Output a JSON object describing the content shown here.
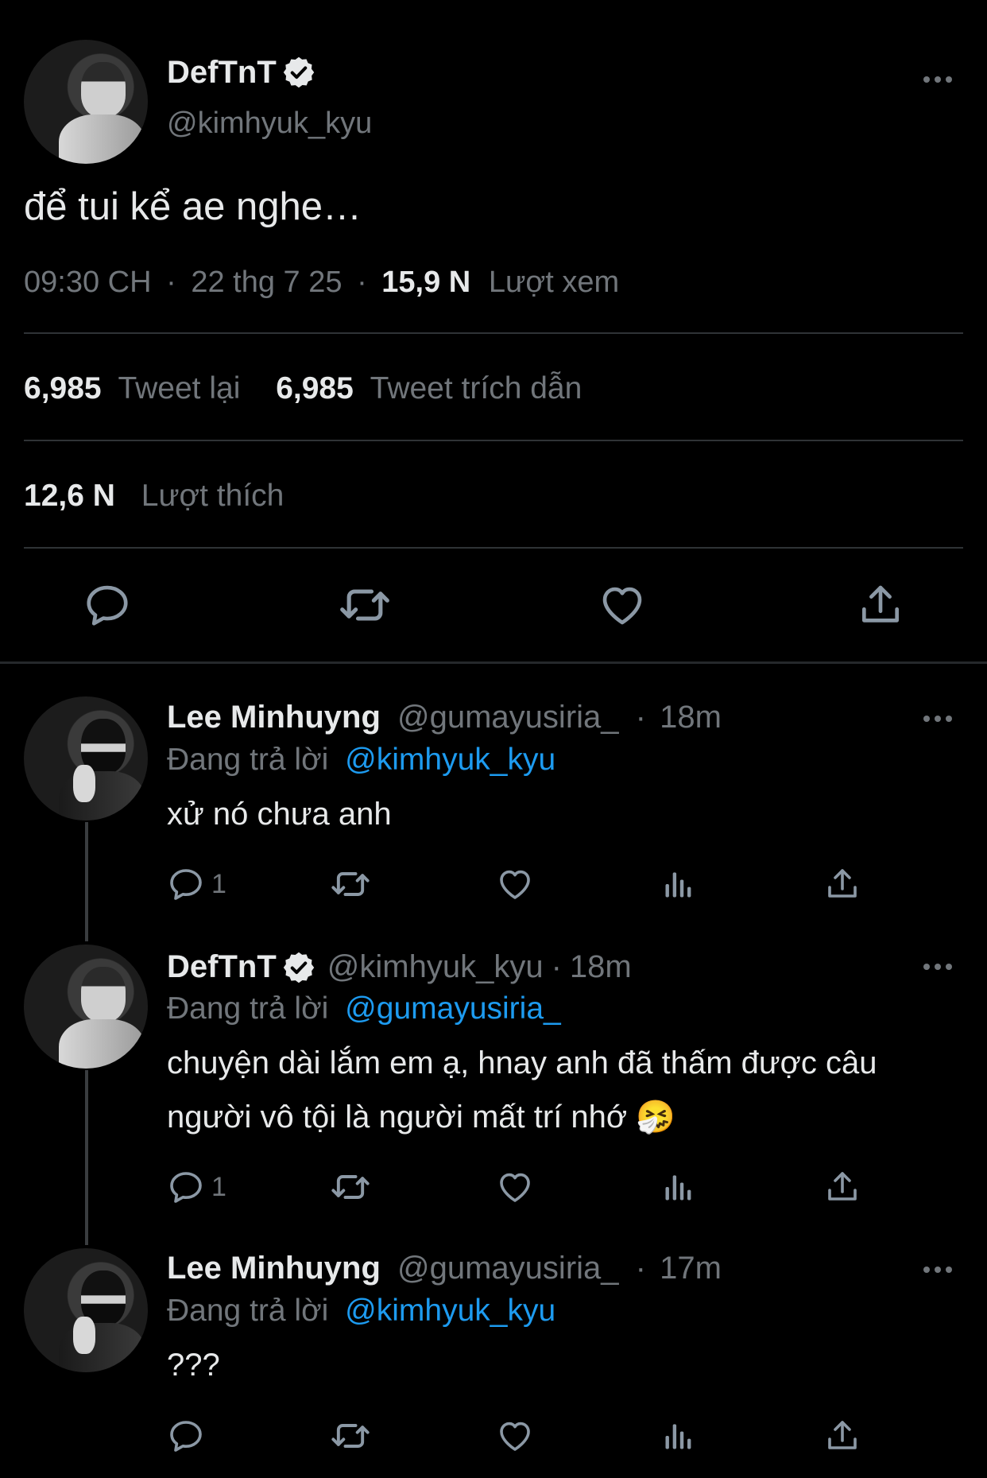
{
  "main_tweet": {
    "display_name": "DefTnT",
    "handle": "@kimhyuk_kyu",
    "text": "để tui kể ae nghe…",
    "time": "09:30 CH",
    "sep1": "·",
    "date": "22 thg 7 25",
    "sep2": "·",
    "views_count": "15,9 N",
    "views_label": "Lượt xem",
    "retweets_count": "6,985",
    "retweets_label": "Tweet lại",
    "quotes_count": "6,985",
    "quotes_label": "Tweet trích dẫn",
    "likes_count": "12,6 N",
    "likes_label": "Lượt thích"
  },
  "replies": [
    {
      "display_name": "Lee Minhuyng",
      "handle": "@gumayusiria_",
      "sep": "·",
      "time": "18m",
      "replying_label": "Đang trả lời",
      "replying_to": "@kimhyuk_kyu",
      "text": "xử nó chưa anh",
      "reply_count": "1"
    },
    {
      "display_name": "DefTnT",
      "handle": "@kimhyuk_kyu",
      "sep": "·",
      "time": "18m",
      "replying_label": "Đang trả lời",
      "replying_to": "@gumayusiria_",
      "text_line1": "chuyện dài lắm em ạ, hnay anh đã thấm được câu",
      "text_line2": "người vô tội là người mất trí nhớ 🤧",
      "reply_count": "1"
    },
    {
      "display_name": "Lee Minhuyng",
      "handle": "@gumayusiria_",
      "sep": "·",
      "time": "17m",
      "replying_label": "Đang trả lời",
      "replying_to": "@kimhyuk_kyu",
      "text": "???",
      "reply_count": ""
    }
  ],
  "colors": {
    "background": "#000000",
    "text": "#e7e9ea",
    "muted": "#71767b",
    "link": "#1d9bf0",
    "divider": "#2f3336"
  },
  "icons": [
    "verified-badge-icon",
    "more-icon",
    "reply-icon",
    "retweet-icon",
    "like-icon",
    "share-icon",
    "views-icon"
  ]
}
